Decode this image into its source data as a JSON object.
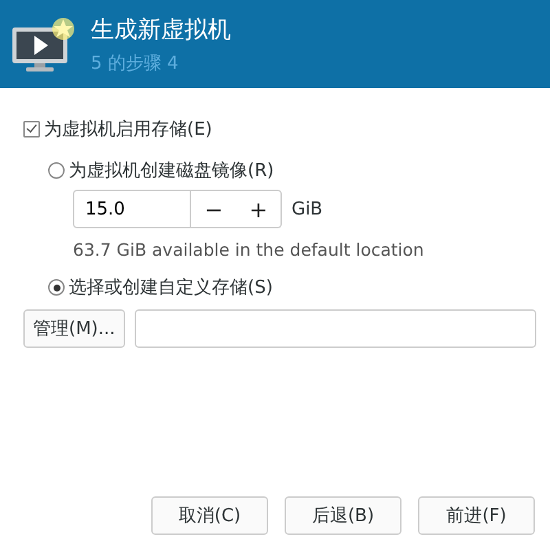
{
  "header": {
    "title": "生成新虚拟机",
    "subtitle": "5 的步骤 4"
  },
  "enable_storage": {
    "label": "为虚拟机启用存储(E)",
    "checked": true
  },
  "options": [
    {
      "kind": "create",
      "label": "为虚拟机创建磁盘镜像(R)",
      "selected": false,
      "size": "15.0",
      "minus": "−",
      "plus": "+",
      "unit": "GiB",
      "info": "63.7 GiB available in the default location"
    },
    {
      "kind": "custom",
      "label": "选择或创建自定义存储(S)",
      "selected": true,
      "manage": "管理(M)..."
    }
  ],
  "buttons": [
    "取消(C)",
    "后退(B)",
    "前进(F)"
  ]
}
